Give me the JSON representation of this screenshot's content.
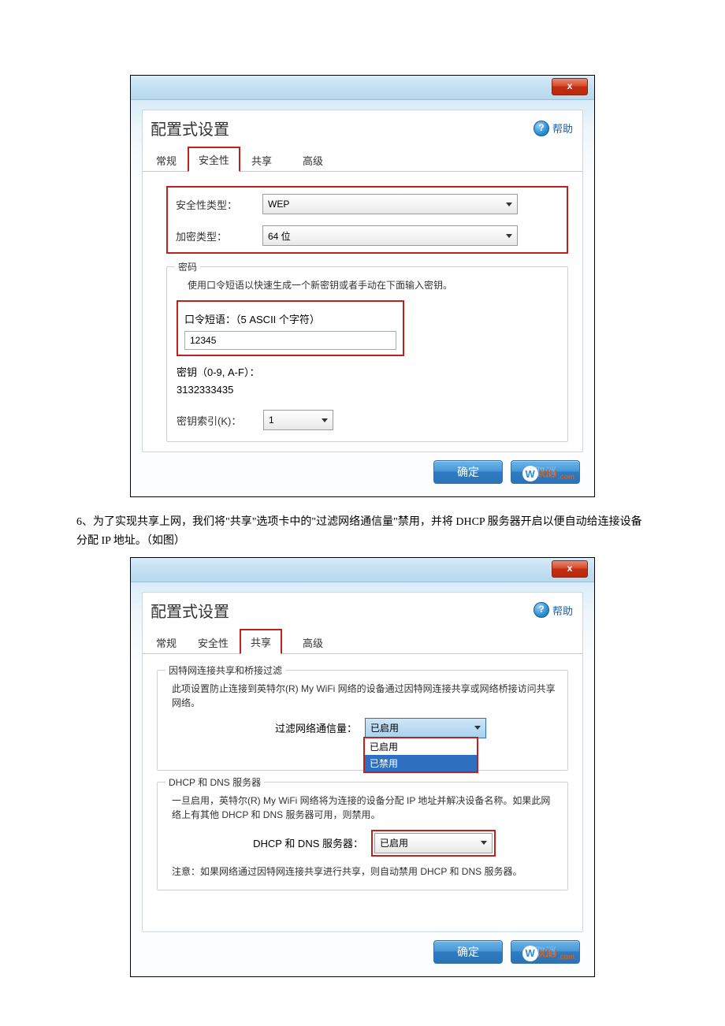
{
  "dialog1": {
    "title": "配置式设置",
    "help": "帮助",
    "close": "x",
    "tabs": [
      "常规",
      "安全性",
      "共享",
      "高级"
    ],
    "activeTabIndex": 1,
    "securityTypeLabel": "安全性类型：",
    "securityTypeValue": "WEP",
    "encryptTypeLabel": "加密类型：",
    "encryptTypeValue": "64 位",
    "pwGroupLegend": "密码",
    "pwDesc": "使用口令短语以快速生成一个新密钥或者手动在下面输入密钥。",
    "passphraseLabel": "口令短语：（5 ASCII 个字符）",
    "passphraseValue": "12345",
    "keyLabel": "密钥（0-9, A-F）：",
    "keyValue": "3132333435",
    "keyIndexLabel": "密钥索引(K)：",
    "keyIndexValue": "1",
    "ok": "确定",
    "cancel": "取消"
  },
  "paragraph": "6、为了实现共享上网，我们将\"共享\"选项卡中的\"过滤网络通信量\"禁用，并将 DHCP 服务器开启以便自动给连接设备分配 IP 地址。（如图）",
  "dialog2": {
    "title": "配置式设置",
    "help": "帮助",
    "close": "x",
    "tabs": [
      "常规",
      "安全性",
      "共享",
      "高级"
    ],
    "activeTabIndex": 2,
    "group1Legend": "因特网连接共享和桥接过滤",
    "group1Desc": "此项设置防止连接到英特尔(R) My WiFi 网络的设备通过因特网连接共享或网络桥接访问共享网络。",
    "filterLabel": "过滤网络通信量：",
    "filterValue": "已启用",
    "filterOptions": [
      "已启用",
      "已禁用"
    ],
    "group2Legend": "DHCP 和 DNS 服务器",
    "group2Desc": "一旦启用，英特尔(R) My WiFi 网络将为连接的设备分配 IP 地址并解决设备名称。如果此网络上有其他 DHCP 和 DNS 服务器可用，则禁用。",
    "dhcpLabel": "DHCP 和 DNS 服务器：",
    "dhcpValue": "已启用",
    "note": "注意：如果网络通过因特网连接共享进行共享，则自动禁用 DHCP 和 DNS 服务器。",
    "ok": "确定",
    "cancel": "取消"
  },
  "watermark": {
    "w": "W",
    "xiu": "XIU",
    "com": ".com"
  }
}
